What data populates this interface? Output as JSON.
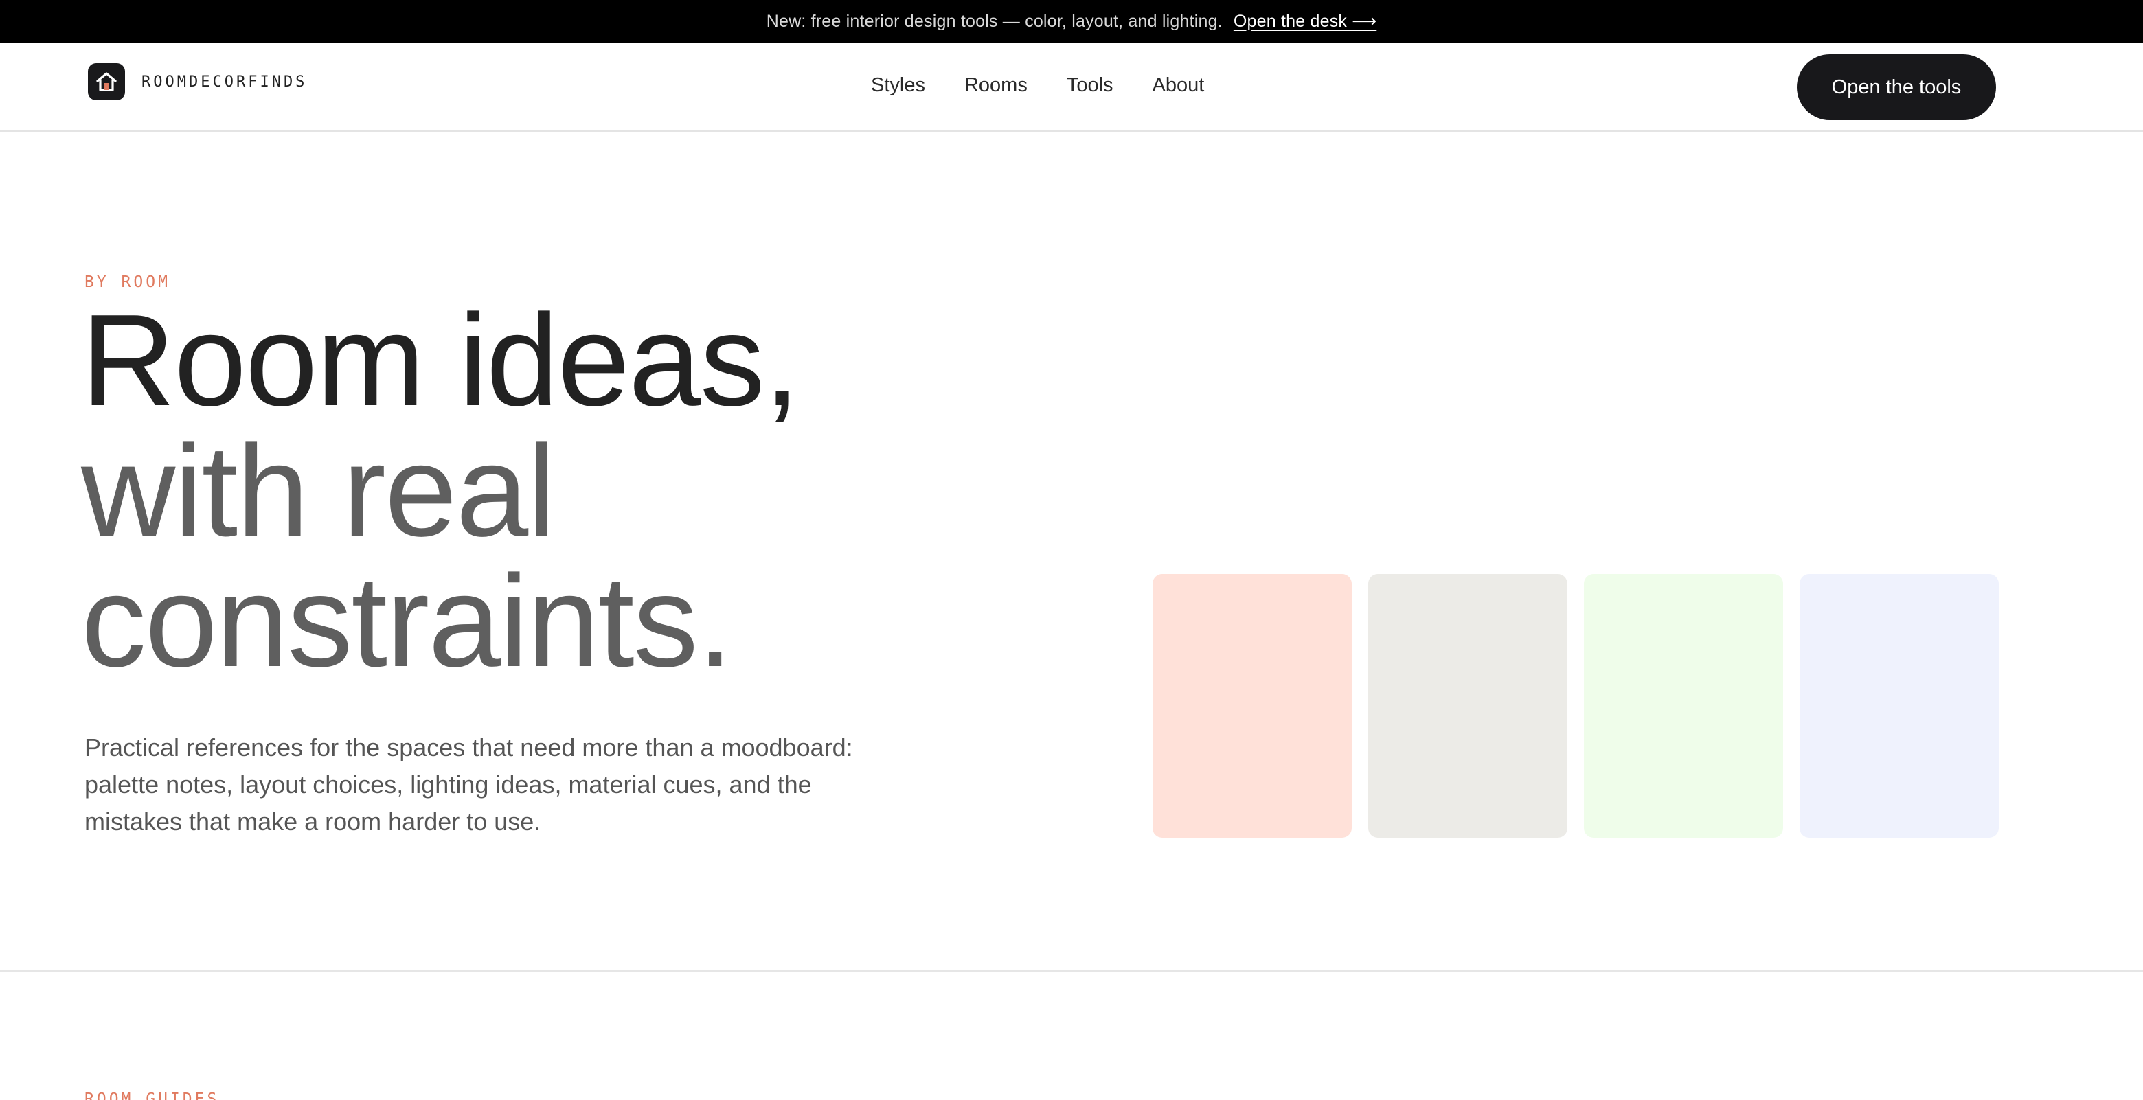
{
  "announcement": {
    "message": "New: free interior design tools — color, layout, and lighting.",
    "link_label": "Open the desk ⟶"
  },
  "header": {
    "brand_name": "ROOMDECORFINDS",
    "brand_icon": "home-icon",
    "nav": [
      "Styles",
      "Rooms",
      "Tools",
      "About"
    ],
    "cta_label": "Open the tools"
  },
  "hero": {
    "eyebrow": "BY ROOM",
    "headline_line1": "Room ideas,",
    "headline_line2": "with real",
    "headline_line3": "constraints.",
    "description": "Practical references for the spaces that need more than a moodboard: palette notes, layout choices, lighting ideas, material cues, and the mistakes that make a room harder to use.",
    "swatch_colors": [
      "#FFE1D9",
      "#ECEBE7",
      "#EFFDEA",
      "#EFF2FD"
    ]
  },
  "next_section": {
    "eyebrow": "ROOM GUIDES"
  },
  "colors": {
    "accent": "#E07A5F",
    "button_dark": "#18181B",
    "announcement_bg": "#000000"
  }
}
